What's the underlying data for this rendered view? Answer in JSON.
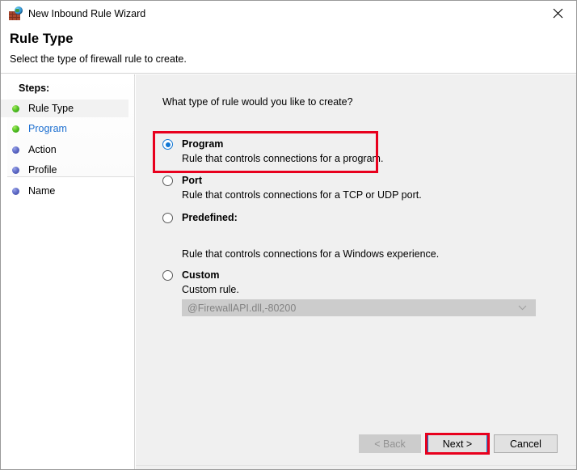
{
  "window": {
    "title": "New Inbound Rule Wizard",
    "icon": "firewall-globe-icon",
    "close_label": "✕"
  },
  "header": {
    "title": "Rule Type",
    "subtitle": "Select the type of firewall rule to create."
  },
  "sidebar": {
    "heading": "Steps:",
    "items": [
      {
        "label": "Rule Type",
        "state": "current",
        "bullet": "green"
      },
      {
        "label": "Program",
        "state": "link",
        "bullet": "green"
      },
      {
        "label": "Action",
        "state": "pending",
        "bullet": "blue"
      },
      {
        "label": "Profile",
        "state": "pending",
        "bullet": "blue"
      },
      {
        "label": "Name",
        "state": "pending",
        "bullet": "blue"
      }
    ]
  },
  "main": {
    "question": "What type of rule would you like to create?",
    "options": [
      {
        "id": "program",
        "title": "Program",
        "description": "Rule that controls connections for a program.",
        "selected": true,
        "highlighted": true
      },
      {
        "id": "port",
        "title": "Port",
        "description": "Rule that controls connections for a TCP or UDP port.",
        "selected": false,
        "highlighted": false
      },
      {
        "id": "predefined",
        "title": "Predefined:",
        "description": "Rule that controls connections for a Windows experience.",
        "selected": false,
        "highlighted": false
      },
      {
        "id": "custom",
        "title": "Custom",
        "description": "Custom rule.",
        "selected": false,
        "highlighted": false
      }
    ],
    "predefined_combo": {
      "value": "@FirewallAPI.dll,-80200",
      "enabled": false,
      "arrow_icon": "chevron-down-icon"
    }
  },
  "footer": {
    "back_label": "< Back",
    "next_label": "Next >",
    "cancel_label": "Cancel",
    "back_enabled": false,
    "next_is_default": true,
    "next_highlighted": true
  },
  "colors": {
    "highlight_red": "#e8001d",
    "accent_blue": "#1277d4",
    "link_blue": "#1d6fd0",
    "panel_gray": "#f0f0f0",
    "disabled_gray": "#cccccc",
    "disabled_text": "#939393"
  }
}
